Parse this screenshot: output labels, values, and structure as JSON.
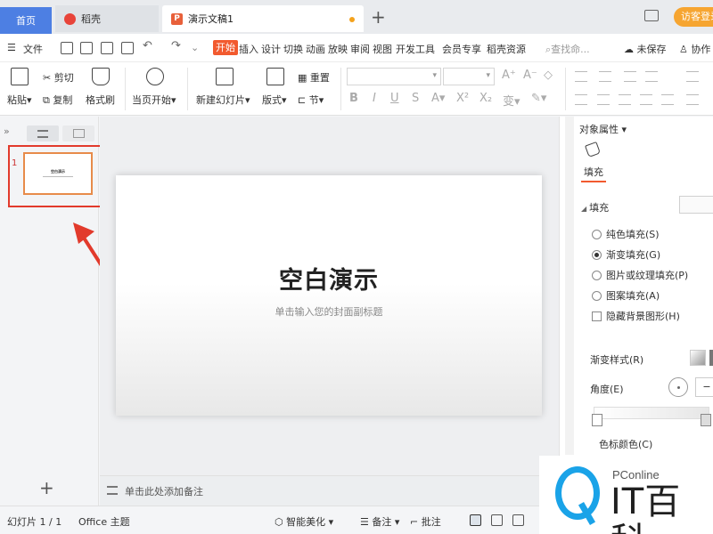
{
  "tabs": {
    "home": "首页",
    "daoke": "稻壳",
    "doc": "演示文稿1",
    "visitor": "访客登录"
  },
  "menu": {
    "file": "文件",
    "items": [
      "开始",
      "插入",
      "设计",
      "切换",
      "动画",
      "放映",
      "审阅",
      "视图",
      "开发工具",
      "会员专享",
      "稻壳资源"
    ],
    "search": "查找命...",
    "unsaved": "未保存",
    "collab": "协作"
  },
  "ribbon": {
    "paste": "粘贴",
    "cut": "剪切",
    "copy": "复制",
    "format_painter": "格式刷",
    "play_from_current": "当页开始",
    "new_slide": "新建幻灯片",
    "layout": "版式",
    "reset": "重置",
    "section": "节"
  },
  "left_panel": {
    "slide_number": "1",
    "thumb_title": "空白演示"
  },
  "slide": {
    "title": "空白演示",
    "subtitle": "单击输入您的封面副标题"
  },
  "notes": {
    "placeholder": "单击此处添加备注"
  },
  "right_panel": {
    "title": "对象属性",
    "tab_fill": "填充",
    "section_fill": "填充",
    "fill_options": [
      {
        "label": "纯色填充(S)",
        "checked": false
      },
      {
        "label": "渐变填充(G)",
        "checked": true
      },
      {
        "label": "图片或纹理填充(P)",
        "checked": false
      },
      {
        "label": "图案填充(A)",
        "checked": false
      }
    ],
    "hide_bg": "隐藏背景图形(H)",
    "gradient_style": "渐变样式(R)",
    "angle": "角度(E)",
    "stop_color": "色标颜色(C)"
  },
  "status": {
    "slide_count": "幻灯片 1 / 1",
    "theme": "Office 主题",
    "smart_beautify": "智能美化",
    "notes": "备注",
    "comments": "批注"
  },
  "watermark": {
    "brand": "PConline",
    "name": "IT百科"
  },
  "colors": {
    "accent": "#f25a2f",
    "home_tab": "#4d7fe3",
    "highlight": "#e23a2c",
    "watermark": "#1aa3e8"
  }
}
